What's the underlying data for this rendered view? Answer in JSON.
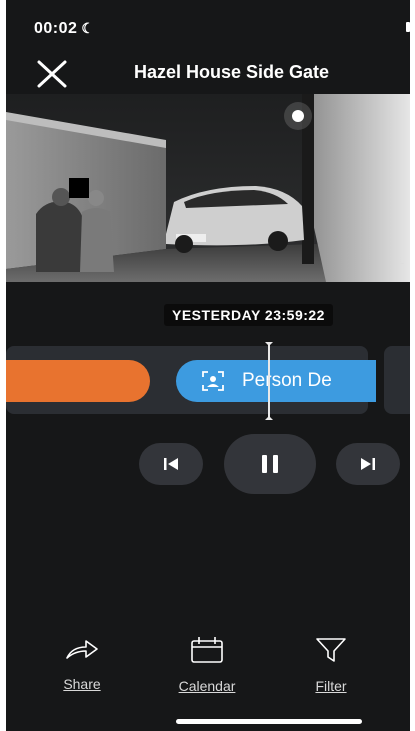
{
  "status_bar": {
    "time": "00:02",
    "moon_glyph": "☾"
  },
  "header": {
    "title": "Hazel House Side Gate",
    "close_icon": "close-icon"
  },
  "video": {
    "timestamp": "YESTERDAY 23:59:22"
  },
  "timeline": {
    "events": [
      {
        "type": "motion",
        "color": "#e8732f"
      },
      {
        "type": "person",
        "label": "Person De",
        "color": "#3d9be0"
      }
    ]
  },
  "controls": {
    "prev_icon": "skip-back-icon",
    "pause_icon": "pause-icon",
    "next_icon": "skip-forward-icon"
  },
  "bottom_bar": {
    "share_label": "Share",
    "calendar_label": "Calendar",
    "filter_label": "Filter"
  },
  "colors": {
    "background": "#161718",
    "accent_orange": "#e8732f",
    "accent_blue": "#3d9be0"
  }
}
